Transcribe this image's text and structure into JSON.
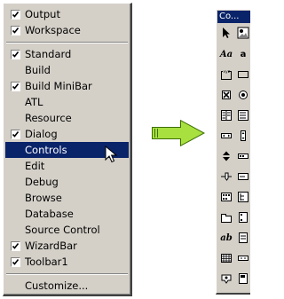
{
  "menu": {
    "items": [
      {
        "label": "Output",
        "checked": true
      },
      {
        "label": "Workspace",
        "checked": true
      },
      {
        "label": "Standard",
        "checked": true
      },
      {
        "label": "Build",
        "checked": false
      },
      {
        "label": "Build MiniBar",
        "checked": true
      },
      {
        "label": "ATL",
        "checked": false
      },
      {
        "label": "Resource",
        "checked": false
      },
      {
        "label": "Dialog",
        "checked": true
      },
      {
        "label": "Controls",
        "checked": false,
        "highlighted": true
      },
      {
        "label": "Edit",
        "checked": false
      },
      {
        "label": "Debug",
        "checked": false
      },
      {
        "label": "Browse",
        "checked": false
      },
      {
        "label": "Database",
        "checked": false
      },
      {
        "label": "Source Control",
        "checked": false
      },
      {
        "label": "WizardBar",
        "checked": true
      },
      {
        "label": "Toolbar1",
        "checked": true
      },
      {
        "label": "Customize...",
        "checked": false
      }
    ]
  },
  "toolbar": {
    "title": "Co...",
    "rows": [
      [
        "pointer-icon",
        "picture-icon"
      ],
      [
        "static-text-icon",
        "edit-box-icon"
      ],
      [
        "group-box-icon",
        "button-icon"
      ],
      [
        "check-box-icon",
        "radio-button-icon"
      ],
      [
        "combo-box-icon",
        "list-box-icon"
      ],
      [
        "horizontal-scrollbar-icon",
        "vertical-scrollbar-icon"
      ],
      [
        "spin-icon",
        "progress-icon"
      ],
      [
        "slider-icon",
        "hotkey-icon"
      ],
      [
        "list-control-icon",
        "tree-control-icon"
      ],
      [
        "tab-control-icon",
        "animate-icon"
      ],
      [
        "rich-edit-icon",
        "date-time-picker-icon"
      ],
      [
        "month-calendar-icon",
        "ip-address-icon"
      ],
      [
        "custom-control-icon",
        "extended-combo-icon"
      ]
    ],
    "glyph_text": {
      "static_text": "Aa",
      "edit_box": "ab",
      "rich_edit": "ab",
      "edit_box_partial": "a"
    }
  },
  "colors": {
    "menu_face": "#d4d0c8",
    "highlight": "#0a246a",
    "arrow_fill": "#a8e040"
  }
}
